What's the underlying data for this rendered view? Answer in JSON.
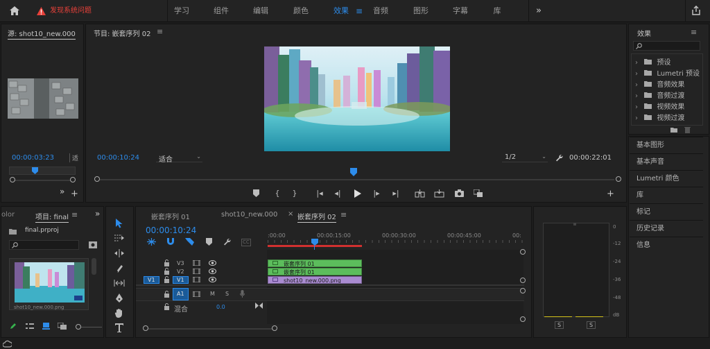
{
  "topbar": {
    "home_icon": "home-icon",
    "warning_icon": "warning-triangle-icon",
    "warning_text": "发现系统问题",
    "workspaces": [
      "学习",
      "组件",
      "编辑",
      "颜色",
      "效果",
      "音频",
      "图形",
      "字幕",
      "库"
    ],
    "active_workspace": "效果",
    "more": "»",
    "export_icon": "share-export-icon"
  },
  "source": {
    "title": "源: shot10_new.000",
    "timecode": "00:00:03:23",
    "fit_label": "适",
    "more": "»",
    "add": "+"
  },
  "program": {
    "title": "节目: 嵌套序列 02",
    "menu": "≡",
    "timecode": "00:00:10:24",
    "fit": "适合",
    "resolution": "1/2",
    "duration": "00:00:22:01",
    "add": "+"
  },
  "project": {
    "tab_partial": "olor",
    "tab": "项目: final",
    "menu": "≡",
    "more": "»",
    "file": "final.prproj",
    "thumb_caption": "shot10_new.000.png"
  },
  "timeline": {
    "tabs": [
      "嵌套序列 01",
      "shot10_new.000",
      "嵌套序列 02"
    ],
    "active_tab": "嵌套序列 02",
    "close": "×",
    "menu": "≡",
    "timecode": "00:00:10:24",
    "ruler": [
      ":00:00",
      "00:00:15:00",
      "00:00:30:00",
      "00:00:45:00",
      "00:"
    ],
    "tracks": {
      "v3": "V3",
      "v2": "V2",
      "v1": "V1",
      "v1_source": "V1",
      "a1": "A1",
      "mute": "M",
      "solo": "S",
      "mix": "混合",
      "mix_value": "0.0"
    },
    "clips": {
      "v3": "嵌套序列 01",
      "v2": "嵌套序列 01",
      "v1": "shot10_new.000.png"
    },
    "cc": "CC"
  },
  "meter": {
    "scale": [
      "0",
      "-12",
      "-24",
      "-36",
      "-48",
      "dB"
    ],
    "solo_left": "S",
    "solo_right": "S"
  },
  "effects": {
    "title": "效果",
    "menu": "≡",
    "search_icon": "search-icon",
    "items": [
      "预设",
      "Lumetri 预设",
      "音频效果",
      "音频过渡",
      "视频效果",
      "视频过渡"
    ]
  },
  "side_panels": [
    "基本图形",
    "基本声音",
    "Lumetri 颜色",
    "库",
    "标记",
    "历史记录",
    "信息"
  ],
  "colors": {
    "accent": "#2d8ceb",
    "warning": "#e8413a",
    "clip_green": "#5cbd5c",
    "clip_purple": "#a98bd0",
    "playhead": "#2d8ceb",
    "work_area": "#d0302f"
  }
}
